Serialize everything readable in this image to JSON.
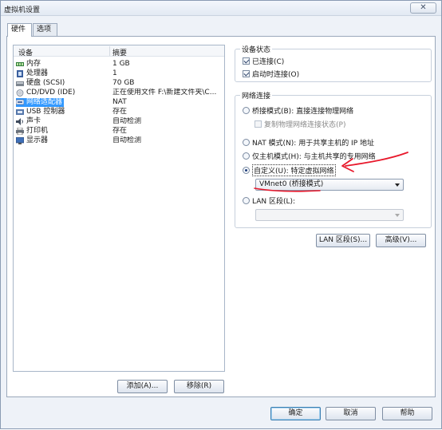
{
  "window": {
    "title": "虚拟机设置",
    "close_glyph": "✕"
  },
  "tabs": [
    {
      "label": "硬件"
    },
    {
      "label": "选项"
    }
  ],
  "device_list": {
    "headers": {
      "device": "设备",
      "summary": "摘要"
    },
    "rows": [
      {
        "name": "内存",
        "summary": "1 GB",
        "icon": "memory-icon"
      },
      {
        "name": "处理器",
        "summary": "1",
        "icon": "processor-icon"
      },
      {
        "name": "硬盘 (SCSI)",
        "summary": "70 GB",
        "icon": "hard-disk-icon"
      },
      {
        "name": "CD/DVD (IDE)",
        "summary": "正在使用文件 F:\\新建文件夹\\C...",
        "icon": "cd-dvd-icon"
      },
      {
        "name": "网络适配器",
        "summary": "NAT",
        "icon": "network-adapter-icon"
      },
      {
        "name": "USB 控制器",
        "summary": "存在",
        "icon": "usb-icon"
      },
      {
        "name": "声卡",
        "summary": "自动检测",
        "icon": "sound-card-icon"
      },
      {
        "name": "打印机",
        "summary": "存在",
        "icon": "printer-icon"
      },
      {
        "name": "显示器",
        "summary": "自动检测",
        "icon": "display-icon"
      }
    ],
    "selected_index": 4
  },
  "buttons": {
    "add": "添加(A)...",
    "remove": "移除(R)",
    "ok": "确定",
    "cancel": "取消",
    "help": "帮助",
    "lan_segments": "LAN 区段(S)...",
    "advanced": "高级(V)..."
  },
  "device_status": {
    "title": "设备状态",
    "connected": "已连接(C)",
    "connect_at_power_on": "启动时连接(O)"
  },
  "network_connection": {
    "title": "网络连接",
    "bridged": "桥接模式(B): 直接连接物理网络",
    "replicate": "复制物理网络连接状态(P)",
    "nat": "NAT 模式(N): 用于共享主机的 IP 地址",
    "host_only": "仅主机模式(H): 与主机共享的专用网络",
    "custom": "自定义(U): 特定虚拟网络",
    "custom_selected_value": "VMnet0 (桥接模式)",
    "lan_segment": "LAN 区段(L):",
    "lan_segment_value": ""
  },
  "colors": {
    "annotation": "#e8192c",
    "selection": "#3399ff"
  }
}
